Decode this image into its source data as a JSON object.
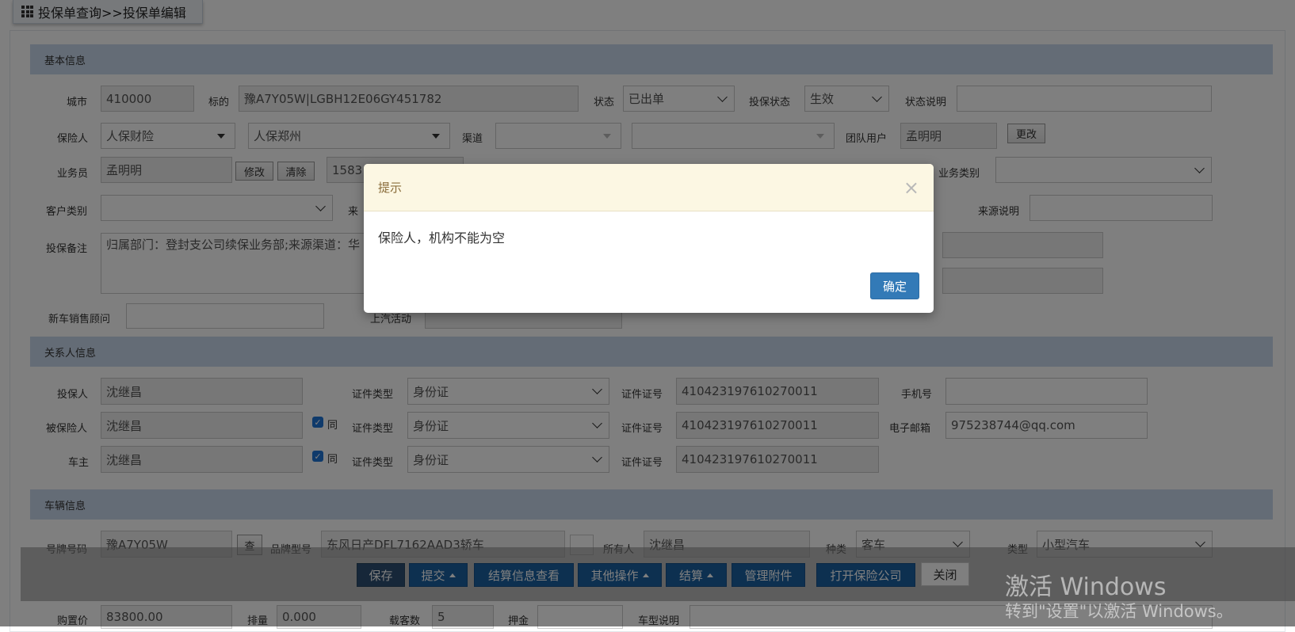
{
  "breadcrumb": "投保单查询>>投保单编辑",
  "sections": {
    "basic": "基本信息",
    "contacts": "关系人信息",
    "vehicle": "车辆信息"
  },
  "basic": {
    "city_label": "城市",
    "city_value": "410000",
    "target_label": "标的",
    "target_value": "豫A7Y05W|LGBH12E06GY451782",
    "status_label": "状态",
    "status_value": "已出单",
    "policy_status_label": "投保状态",
    "policy_status_value": "生效",
    "status_note_label": "状态说明",
    "insurer_label": "保险人",
    "insurer_value": "人保财险",
    "insurer_branch_value": "人保郑州",
    "channel_label": "渠道",
    "team_user_label": "团队用户",
    "team_user_value": "孟明明",
    "change_button": "更改",
    "salesman_label": "业务员",
    "salesman_value": "孟明明",
    "modify_button": "修改",
    "clear_button": "清除",
    "phone_partial": "1583",
    "biz_type_label": "业务类别",
    "customer_type_label": "客户类别",
    "source_partial": "来",
    "source_note_label": "来源说明",
    "remark_label": "投保备注",
    "remark_value": "归属部门：登封支公司续保业务部;来源渠道：华",
    "new_car_advisor_label": "新车销售顾问",
    "saic_activity_label": "上汽活动"
  },
  "contacts": {
    "applicant_label": "投保人",
    "applicant_value": "沈继昌",
    "insured_label": "被保险人",
    "insured_value": "沈继昌",
    "owner_label": "车主",
    "owner_value": "沈继昌",
    "same_label": "同",
    "id_type_label": "证件类型",
    "id_type_value": "身份证",
    "id_no_label": "证件证号",
    "id_no_value": "410423197610270011",
    "mobile_label": "手机号",
    "email_label": "电子邮箱",
    "email_value": "975238744@qq.com"
  },
  "vehicle": {
    "plate_label": "号牌号码",
    "plate_value": "豫A7Y05W",
    "check_button": "查",
    "model_label": "品牌型号",
    "model_value": "东风日产DFL7162AAD3轿车",
    "owner_label": "所有人",
    "owner_value": "沈继昌",
    "kind_label": "种类",
    "kind_value": "客车",
    "type_label": "类型",
    "type_value": "小型汽车",
    "price_label": "购置价",
    "price_value": "83800.00",
    "displacement_label": "排量",
    "displacement_value": "0.000",
    "seats_label": "载客数",
    "seats_value": "5",
    "deposit_label": "押金",
    "model_note_label": "车型说明"
  },
  "toolbar": {
    "save": "保存",
    "submit": "提交",
    "settlement_view": "结算信息查看",
    "other_ops": "其他操作",
    "settle": "结算",
    "attachments": "管理附件",
    "open_insurer": "打开保险公司",
    "close": "关闭"
  },
  "watermark": {
    "line1": "激活 Windows",
    "line2": "转到\"设置\"以激活 Windows。"
  },
  "modal": {
    "title": "提示",
    "message": "保险人，机构不能为空",
    "ok_button": "确定",
    "close_glyph": "×"
  }
}
